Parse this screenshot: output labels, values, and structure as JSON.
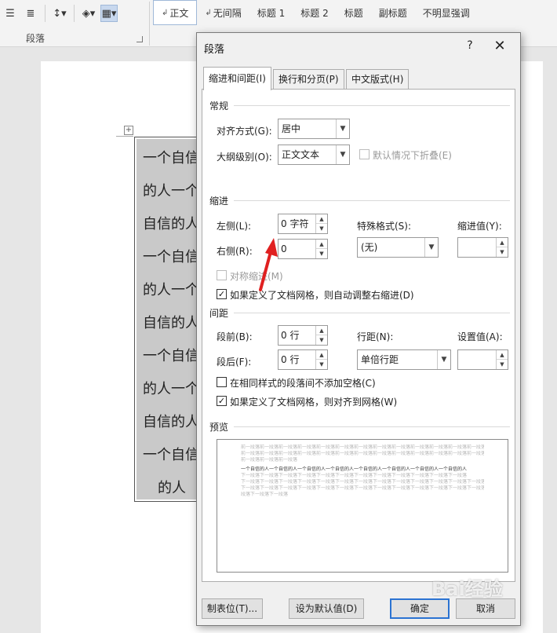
{
  "ribbon": {
    "group_label": "段落",
    "styles": [
      {
        "label": "正文",
        "active": true
      },
      {
        "label": "无间隔",
        "active": false
      },
      {
        "label": "标题 1",
        "active": false
      },
      {
        "label": "标题 2",
        "active": false
      },
      {
        "label": "标题",
        "active": false
      },
      {
        "label": "副标题",
        "active": false
      },
      {
        "label": "不明显强调",
        "active": false
      }
    ]
  },
  "document": {
    "lines": [
      "一个自信",
      "的人一个",
      "自信的人",
      "一个自信",
      "的人一个",
      "自信的人",
      "一个自信",
      "的人一个",
      "自信的人",
      "一个自信",
      "的人"
    ]
  },
  "dialog": {
    "title": "段落",
    "help": "?",
    "close": "✕",
    "tabs": [
      "缩进和间距(I)",
      "换行和分页(P)",
      "中文版式(H)"
    ],
    "general": {
      "heading": "常规",
      "alignment_label": "对齐方式(G):",
      "alignment_value": "居中",
      "outline_label": "大纲级别(O):",
      "outline_value": "正文文本",
      "collapse_label": "默认情况下折叠(E)"
    },
    "indent": {
      "heading": "缩进",
      "left_label": "左侧(L):",
      "left_value": "0 字符",
      "right_label": "右侧(R):",
      "right_value": "0",
      "special_label": "特殊格式(S):",
      "special_value": "(无)",
      "by_label": "缩进值(Y):",
      "by_value": "",
      "mirror_label": "对称缩进(M)",
      "auto_adjust_label": "如果定义了文档网格，则自动调整右缩进(D)"
    },
    "spacing": {
      "heading": "间距",
      "before_label": "段前(B):",
      "before_value": "0 行",
      "after_label": "段后(F):",
      "after_value": "0 行",
      "line_label": "行距(N):",
      "line_value": "单倍行距",
      "at_label": "设置值(A):",
      "at_value": "",
      "no_space_label": "在相同样式的段落间不添加空格(C)",
      "snap_grid_label": "如果定义了文档网格，则对齐到网格(W)"
    },
    "preview": {
      "heading": "预览",
      "prev_text": "前一段落前一段落前一段落前一段落前一段落前一段落前一段落前一段落前一段落前一段落前一段落前一段落前一段落",
      "prev_short": "前一段落前一段落前一段落",
      "sample_text": "一个自信的人一个自信的人一个自信的人一个自信的人一个自信的人一个自信的人一个自信的人一个自信的人",
      "sample_short": "下一段落下一段落下一段落下一段落下一段落下一段落下一段落下一段落下一段落下一段落下一段落下一段落",
      "next_text": "下一段落下一段落下一段落下一段落下一段落下一段落下一段落下一段落下一段落下一段落下一段落下一段落下一段落",
      "next_short": "段落下一段落下一段落"
    },
    "buttons": {
      "tabs": "制表位(T)...",
      "set_default": "设为默认值(D)",
      "ok": "确定",
      "cancel": "取消"
    }
  },
  "watermark": "Bai经验"
}
